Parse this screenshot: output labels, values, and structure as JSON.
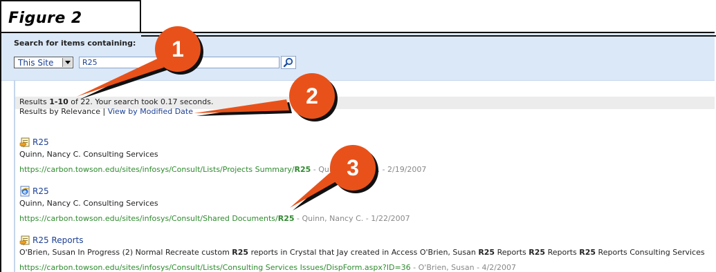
{
  "figure_label": "Figure 2",
  "search": {
    "heading": "Search for items containing:",
    "scope": "This Site",
    "query": "R25",
    "button_icon": "magnifier-icon"
  },
  "summary": {
    "prefix": "Results ",
    "range": "1-10",
    "middle": " of 22. Your search took 0.17 seconds.",
    "sort_current": "Results by Relevance",
    "separator": " | ",
    "sort_link": "View by Modified Date"
  },
  "results": [
    {
      "icon": "list-item-icon",
      "title": "R25",
      "description": "Quinn, Nancy C. Consulting Services",
      "url_prefix": "https://carbon.towson.edu/sites/infosys/Consult/Lists/Projects Summary/",
      "url_term": "R25",
      "meta": " - Quinn, Nancy C. - 2/19/2007"
    },
    {
      "icon": "ie-document-icon",
      "title": "R25",
      "description": "Quinn, Nancy C. Consulting Services",
      "url_prefix": "https://carbon.towson.edu/sites/infosys/Consult/Shared Documents/",
      "url_term": "R25",
      "meta": " - Quinn, Nancy C. - 1/22/2007"
    },
    {
      "icon": "list-item-icon",
      "title": "R25 Reports",
      "description_parts": [
        "O'Brien, Susan In Progress (2) Normal Recreate custom ",
        "R25",
        " reports in Crystal that Jay created in Access O'Brien, Susan ",
        "R25",
        " Reports ",
        "R25",
        " Reports ",
        "R25",
        " Reports Consulting Services"
      ],
      "url_prefix": "https://carbon.towson.edu/sites/infosys/Consult/Lists/Consulting Services Issues/DispForm.aspx?ID=36",
      "meta": " - O'Brien, Susan - 4/2/2007"
    }
  ],
  "callouts": [
    "1",
    "2",
    "3"
  ],
  "colors": {
    "callout": "#e8521a",
    "link": "#1b3f95",
    "url": "#2f8a2f",
    "panel": "#dbe8f8"
  }
}
